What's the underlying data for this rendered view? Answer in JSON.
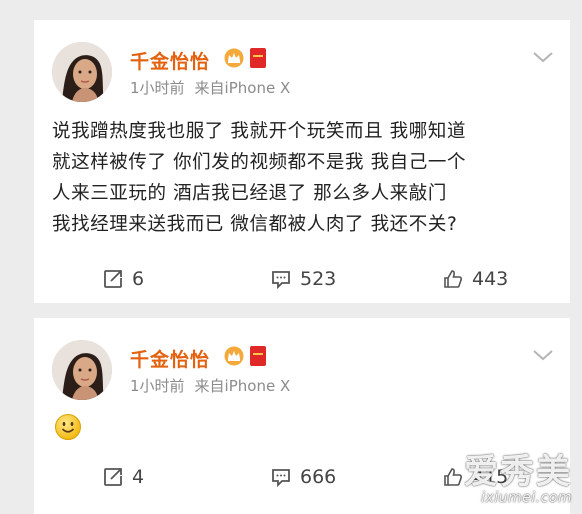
{
  "posts": [
    {
      "user_name": "千金怡怡",
      "time": "1小时前",
      "source": "来自iPhone X",
      "text_lines": [
        "说我蹭热度我也服了 我就开个玩笑而且 我哪知道",
        "就这样被传了 你们发的视频都不是我 我自己一个",
        "人来三亚玩的 酒店我已经退了 那么多人来敲门",
        "我找经理来送我而已 微信都被人肉了 我还不关?"
      ],
      "reposts": "6",
      "comments": "523",
      "likes": "443",
      "icons": {
        "avatar": "avatar-image",
        "crown": "crown-badge-icon",
        "red": "red-packet-badge-icon",
        "more": "chevron-down-icon",
        "repost": "repost-icon",
        "comment": "comment-icon",
        "like": "like-thumb-icon"
      }
    },
    {
      "user_name": "千金怡怡",
      "time": "1小时前",
      "source": "来自iPhone X",
      "emoji": "smiley-emoji",
      "reposts": "4",
      "comments": "666",
      "likes": "415"
    }
  ],
  "watermark": {
    "main": "爱秀美",
    "url": "ixiumei.com"
  },
  "colors": {
    "username": "#e4620f",
    "meta": "#8b8b8b",
    "background": "#ececec",
    "card": "#ffffff"
  }
}
